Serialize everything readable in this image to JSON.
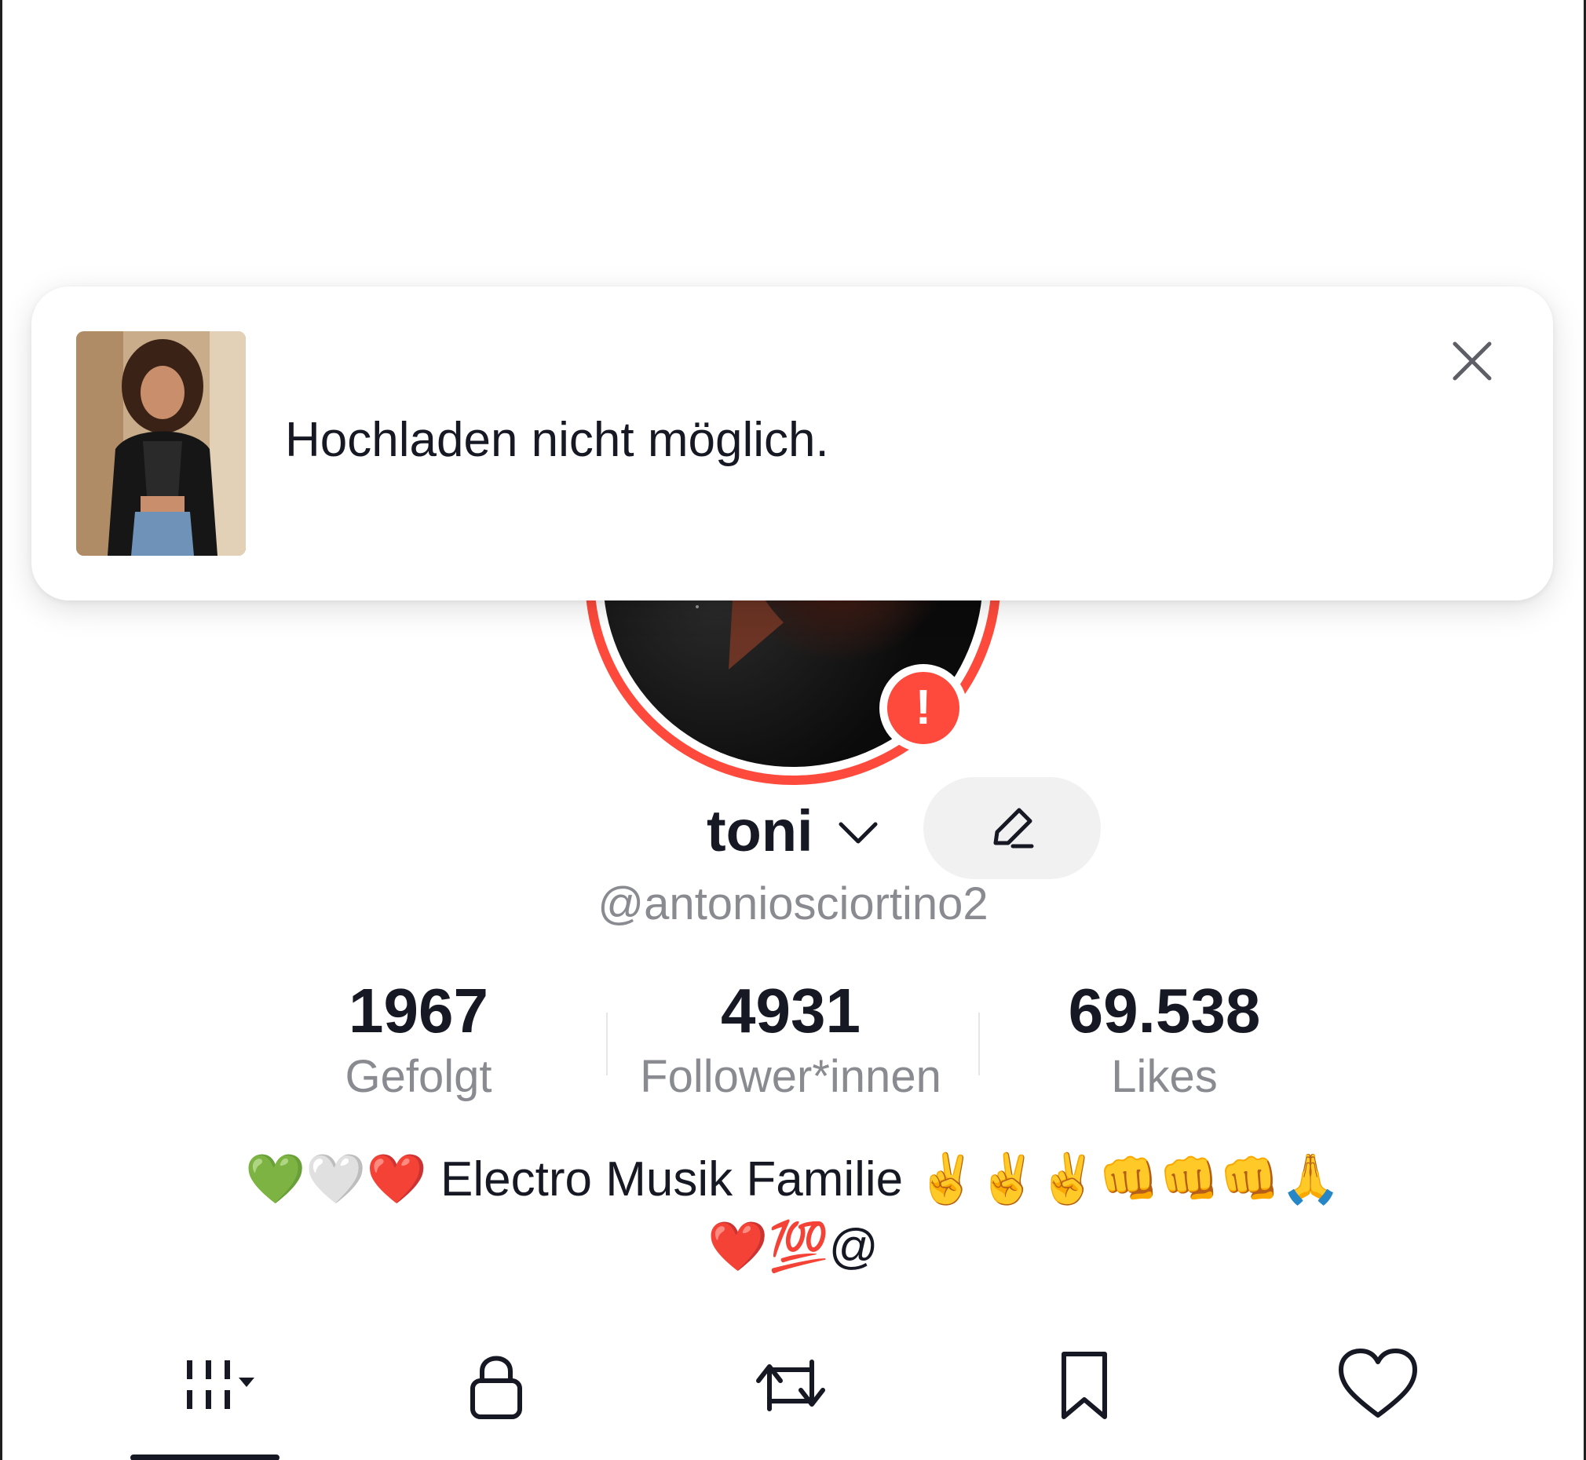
{
  "toast": {
    "message": "Hochladen nicht möglich.",
    "thumbnail_icon": "photo-thumbnail",
    "close_icon": "close-icon"
  },
  "profile": {
    "display_name": "toni",
    "username": "@antoniosciortino2",
    "alert_symbol": "!",
    "accent_color": "#fe4a3c"
  },
  "stats": [
    {
      "value": "1967",
      "label": "Gefolgt"
    },
    {
      "value": "4931",
      "label": "Follower*innen"
    },
    {
      "value": "69.538",
      "label": "Likes"
    }
  ],
  "bio": {
    "line1": "💚🤍❤️ Electro Musik Familie ✌️✌️✌️👊👊👊🙏",
    "line2": "❤️💯@"
  },
  "tabs": [
    {
      "name": "videos",
      "icon": "grid-icon",
      "active": true
    },
    {
      "name": "private",
      "icon": "lock-icon",
      "active": false
    },
    {
      "name": "reposts",
      "icon": "repost-icon",
      "active": false
    },
    {
      "name": "favorites",
      "icon": "bookmark-icon",
      "active": false
    },
    {
      "name": "liked",
      "icon": "heart-icon",
      "active": false
    }
  ]
}
